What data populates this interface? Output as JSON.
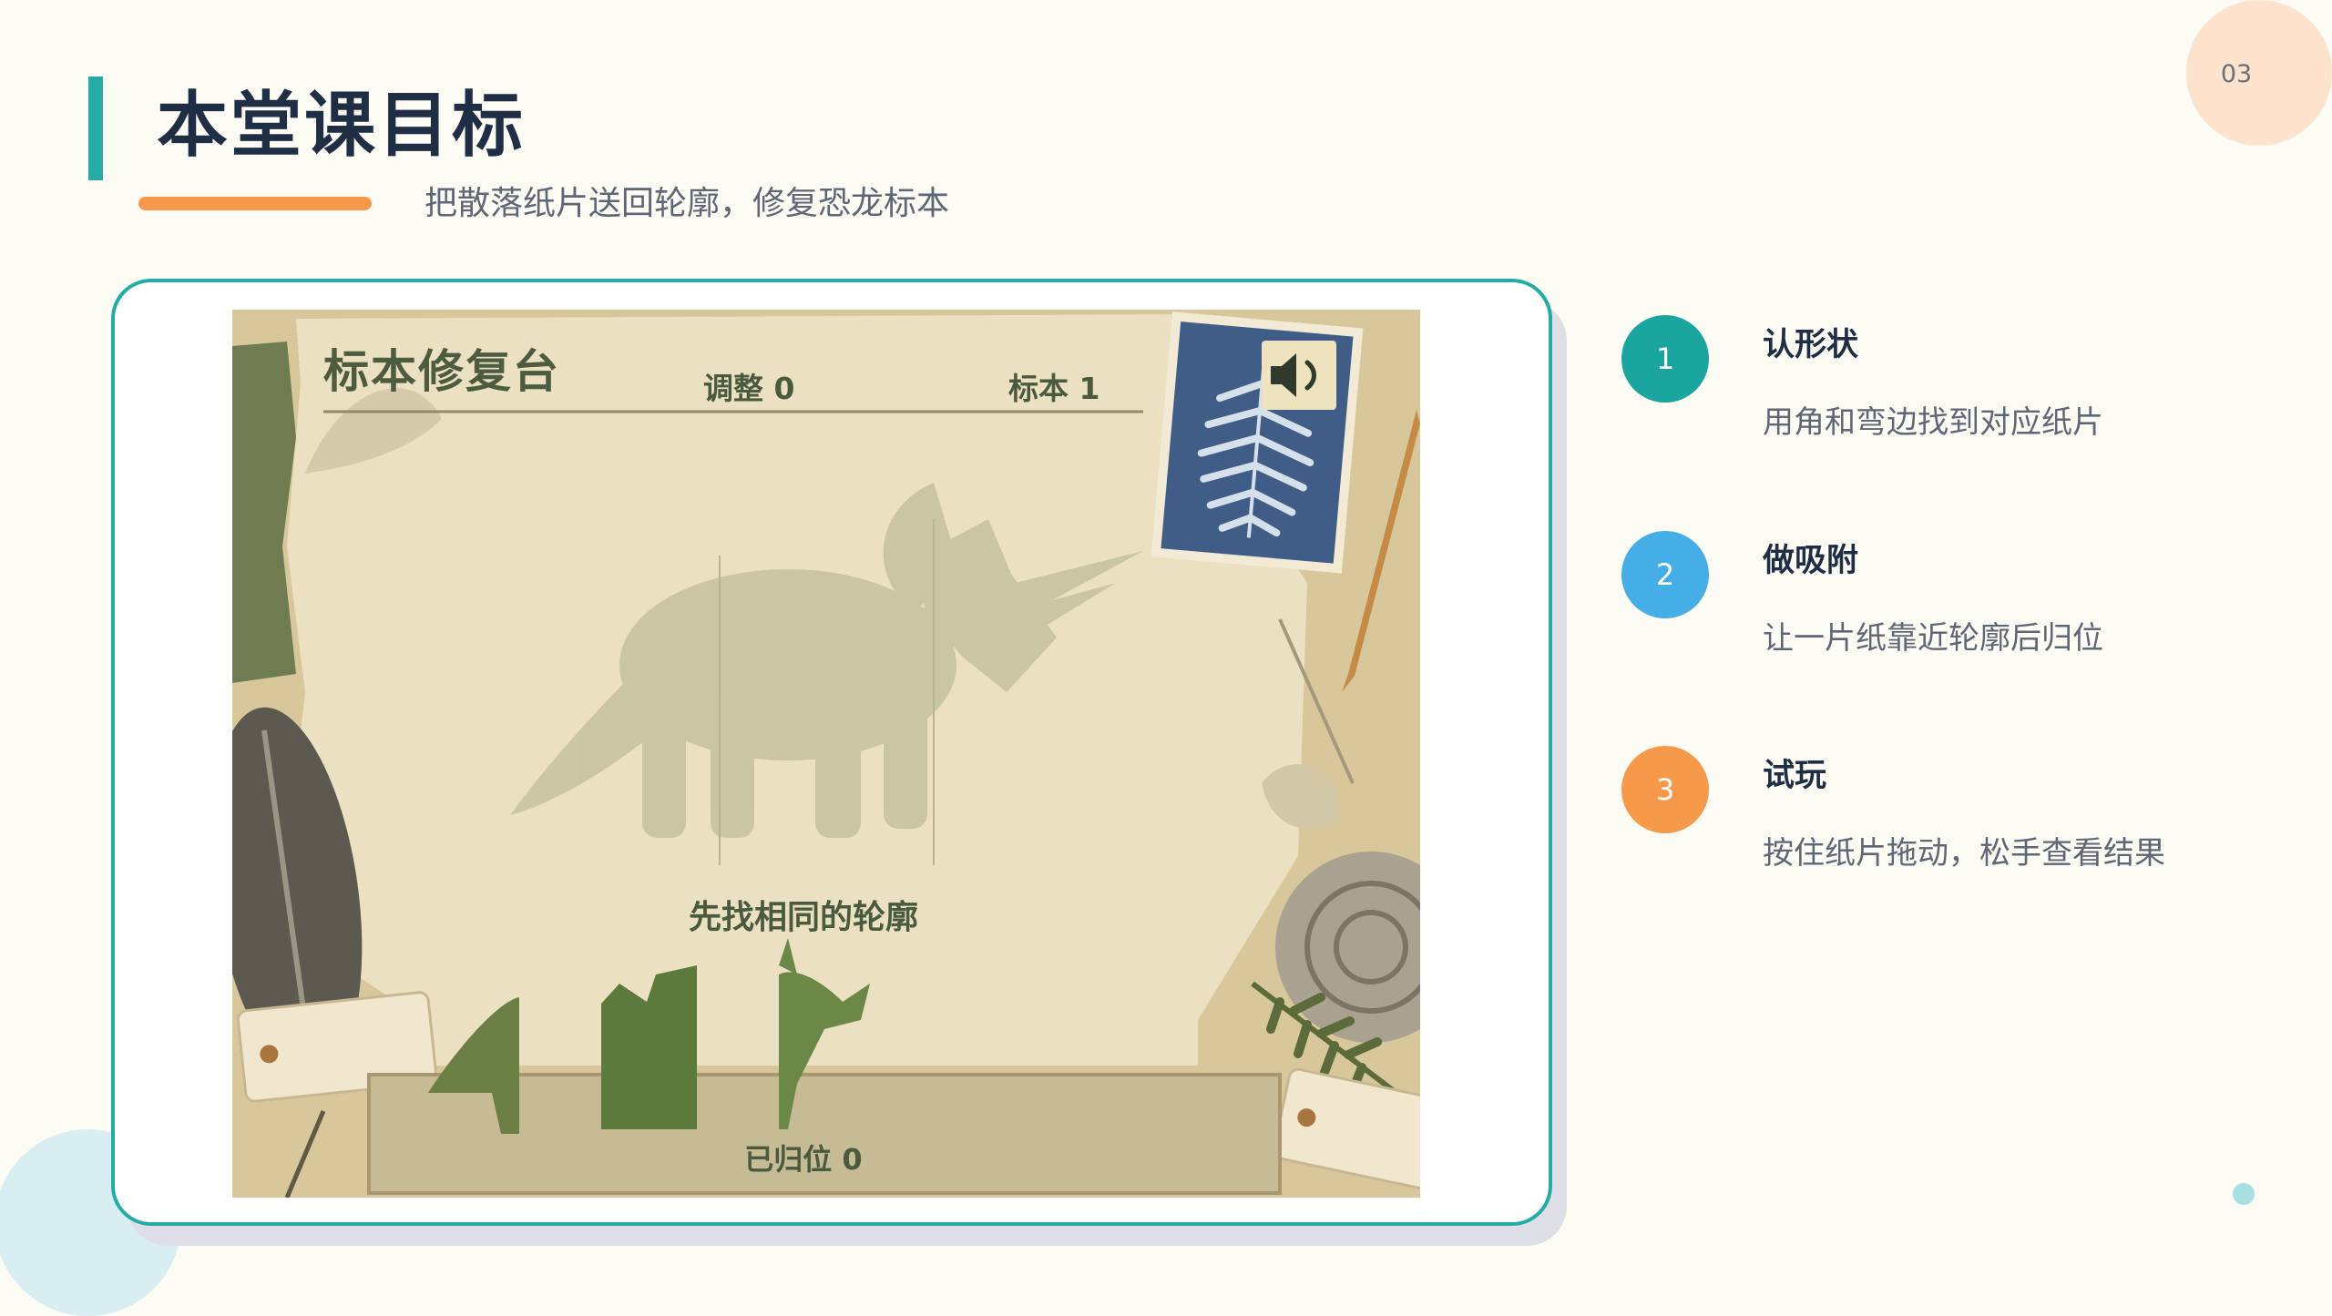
{
  "page_number": "03",
  "header": {
    "title": "本堂课目标",
    "subtitle": "把散落纸片送回轮廓，修复恐龙标本"
  },
  "game": {
    "title": "标本修复台",
    "adjust_label": "调整 0",
    "specimen_label": "标本 1",
    "sound_icon": "speaker-icon",
    "hint": "先找相同的轮廓",
    "placed_label": "已归位 0"
  },
  "steps": [
    {
      "number": "1",
      "title": "认形状",
      "desc": "用角和弯边找到对应纸片",
      "color": "#1aa69e"
    },
    {
      "number": "2",
      "title": "做吸附",
      "desc": "让一片纸靠近轮廓后归位",
      "color": "#45aee6"
    },
    {
      "number": "3",
      "title": "试玩",
      "desc": "按住纸片拖动，松手查看结果",
      "color": "#f7994a"
    }
  ],
  "colors": {
    "accent": "#25aba6",
    "highlight": "#f7994a",
    "background": "#fcfbf4"
  }
}
